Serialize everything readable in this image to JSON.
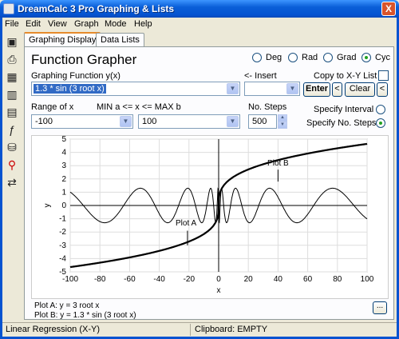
{
  "window": {
    "title": "DreamCalc 3 Pro Graphing & Lists",
    "close_glyph": "X"
  },
  "menu": [
    "File",
    "Edit",
    "View",
    "Graph",
    "Mode",
    "Help"
  ],
  "toolbar": [
    "save-icon",
    "print-icon",
    "calculator-icon",
    "chart-icon",
    "table-icon",
    "function-icon",
    "trash-icon",
    "zoom-icon",
    "swap-icon"
  ],
  "tabs": [
    {
      "label": "Graphing Display"
    },
    {
      "label": "Data Lists"
    }
  ],
  "panel": {
    "heading": "Function Grapher",
    "angle_modes": [
      {
        "label": "Deg",
        "selected": false
      },
      {
        "label": "Rad",
        "selected": false
      },
      {
        "label": "Grad",
        "selected": false
      },
      {
        "label": "Cyc",
        "selected": true
      }
    ],
    "graphing_function_label": "Graphing Function y(x)",
    "graphing_function_value": "1.3 * sin (3 root x)",
    "insert_label": "<- Insert",
    "insert_value": "",
    "copy_label": "Copy to X-Y List",
    "enter_label": "Enter",
    "back_label": "<",
    "clear_label": "Clear",
    "clear_back_label": "<",
    "range_label": "Range of x",
    "minmax_label": "MIN a <= x <= MAX b",
    "min_value": "-100",
    "max_value": "100",
    "steps_label": "No. Steps",
    "steps_value": "500",
    "specify_interval_label": "Specify Interval",
    "specify_steps_label": "Specify No. Steps",
    "legend_a": "Plot A: y = 3 root x",
    "legend_b": "Plot B: y = 1.3 * sin (3 root x)",
    "more_label": "..."
  },
  "chart_data": {
    "type": "line",
    "xlabel": "x",
    "ylabel": "y",
    "xlim": [
      -100,
      100
    ],
    "ylim": [
      -5,
      5
    ],
    "xticks": [
      -100,
      -80,
      -60,
      -40,
      -20,
      0,
      20,
      40,
      60,
      80,
      100
    ],
    "yticks": [
      5,
      4,
      3,
      2,
      1,
      0,
      -1,
      -2,
      -3,
      -4,
      -5
    ],
    "grid": true,
    "series": [
      {
        "name": "Plot A",
        "function": "3 root x"
      },
      {
        "name": "Plot B",
        "function": "1.3 * sin (3 root x)"
      }
    ],
    "annotations": [
      "Plot A",
      "Plot B"
    ]
  },
  "status": {
    "left": "Linear Regression (X-Y)",
    "right": "Clipboard: EMPTY"
  }
}
